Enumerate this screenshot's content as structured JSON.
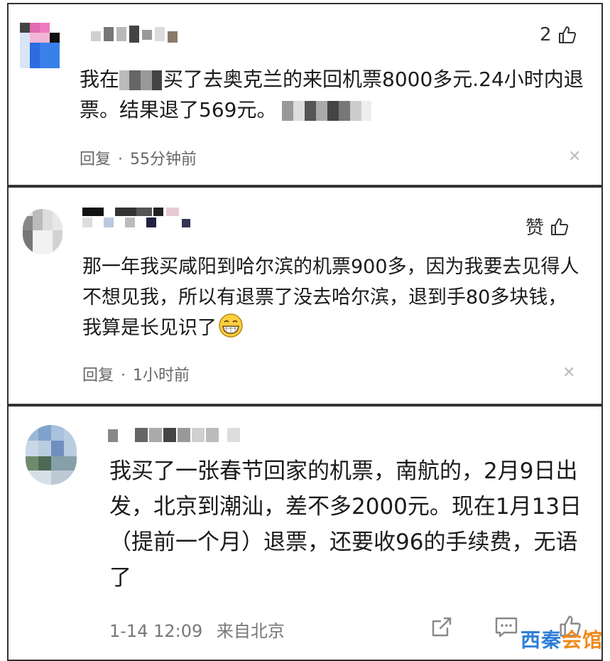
{
  "comments": [
    {
      "likes_label": "2",
      "body_prefix": "我在",
      "body_mid": "买了去奥克兰的来回机票8000多元.24小时内退票。结果退了569元。",
      "reply_label": "回复",
      "time": "55分钟前"
    },
    {
      "likes_label": "赞",
      "body": "那一年我买咸阳到哈尔滨的机票900多，因为我要去见得人不想见我，所以有退票了没去哈尔滨，退到手80多块钱，我算是长见识了",
      "reply_label": "回复",
      "time": "1小时前"
    },
    {
      "body": "我买了一张春节回家的机票，南航的，2月9日出发，北京到潮汕，差不多2000元。现在1月13日（提前一个月）退票，还要收96的手续费，无语了",
      "time": "1-14 12:09",
      "location": "来自北京"
    }
  ],
  "watermark": "西秦会馆",
  "colors": {
    "watermark_blue": "#2f7fd8",
    "watermark_orange": "#f08a1c",
    "meta_gray": "#666666"
  }
}
